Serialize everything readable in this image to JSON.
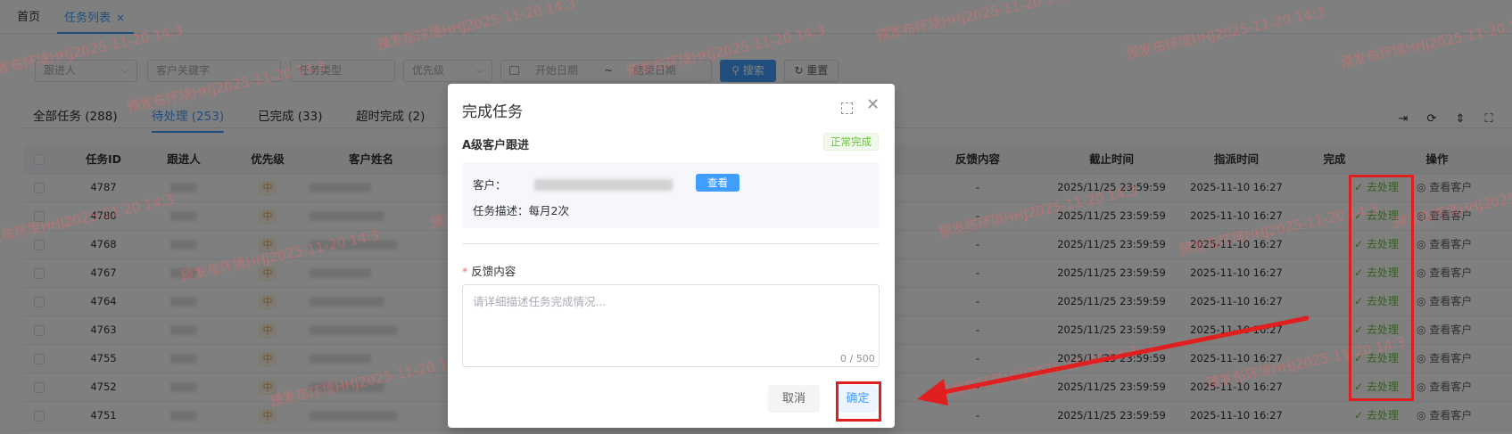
{
  "tabs": {
    "home": "首页",
    "list": "任务列表",
    "close": "×"
  },
  "filters": {
    "follower": "跟进人",
    "customer_kw": "客户关键字",
    "task_type": "任务类型",
    "priority": "优先级",
    "start_date": "开始日期",
    "date_sep": "~",
    "end_date": "结束日期",
    "search": "搜索",
    "reset": "重置"
  },
  "status_tabs": [
    {
      "label": "全部任务 (288)"
    },
    {
      "label": "待处理 (253)"
    },
    {
      "label": "已完成 (33)"
    },
    {
      "label": "超时完成 (2)"
    }
  ],
  "table": {
    "headers": {
      "id": "任务ID",
      "follower": "跟进人",
      "priority": "优先级",
      "customer": "客户姓名",
      "feedback": "反馈内容",
      "deadline": "截止时间",
      "dispatch": "指派时间",
      "complete": "完成",
      "ops": "操作"
    },
    "rows": [
      {
        "id": "4787",
        "priority": "中",
        "feedback": "-",
        "deadline": "2025/11/25 23:59:59",
        "dispatch": "2025-11-10 16:27"
      },
      {
        "id": "4780",
        "priority": "中",
        "feedback": "-",
        "deadline": "2025/11/25 23:59:59",
        "dispatch": "2025-11-10 16:27"
      },
      {
        "id": "4768",
        "priority": "中",
        "feedback": "-",
        "deadline": "2025/11/25 23:59:59",
        "dispatch": "2025-11-10 16:27"
      },
      {
        "id": "4767",
        "priority": "中",
        "feedback": "-",
        "deadline": "2025/11/25 23:59:59",
        "dispatch": "2025-11-10 16:27"
      },
      {
        "id": "4764",
        "priority": "中",
        "feedback": "-",
        "deadline": "2025/11/25 23:59:59",
        "dispatch": "2025-11-10 16:27"
      },
      {
        "id": "4763",
        "priority": "中",
        "feedback": "-",
        "deadline": "2025/11/25 23:59:59",
        "dispatch": "2025-11-10 16:27"
      },
      {
        "id": "4755",
        "priority": "中",
        "feedback": "-",
        "deadline": "2025/11/25 23:59:59",
        "dispatch": "2025-11-10 16:27"
      },
      {
        "id": "4752",
        "priority": "中",
        "feedback": "-",
        "deadline": "2025/11/25 23:59:59",
        "dispatch": "2025-11-10 16:27"
      },
      {
        "id": "4751",
        "priority": "中",
        "feedback": "-",
        "deadline": "2025/11/25 23:59:59",
        "dispatch": "2025-11-10 16:27"
      }
    ],
    "op_process": "✓ 去处理",
    "op_view": "◎ 查看客户"
  },
  "dialog": {
    "title": "完成任务",
    "task_name": "A级客户跟进",
    "status_badge": "正常完成",
    "customer_label": "客户：",
    "view_button": "查看",
    "description": "任务描述：每月2次",
    "feedback_label": "反馈内容",
    "feedback_placeholder": "请详细描述任务完成情况...",
    "feedback_count": "0 / 500",
    "cancel": "取消",
    "confirm": "确定"
  },
  "watermark_text": "预发布环境HHJ2025-11-20 14:3",
  "colors": {
    "primary": "#409eff",
    "success": "#67c23a",
    "annotation": "#e02020"
  }
}
